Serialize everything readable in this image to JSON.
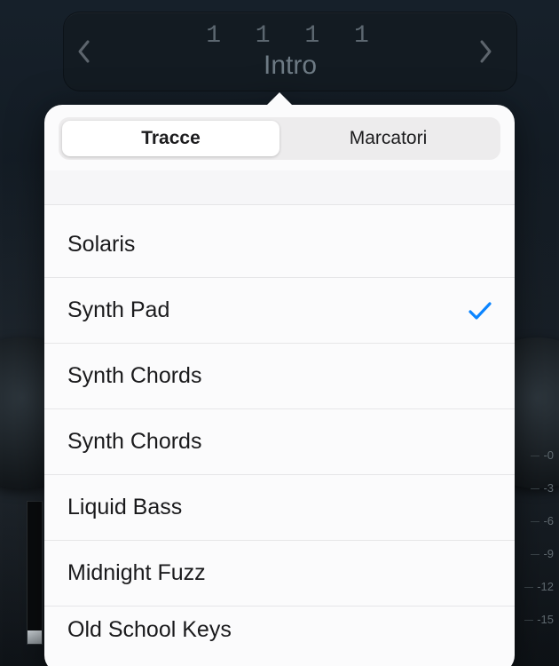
{
  "nav": {
    "position": "1 1 1   1",
    "marker": "Intro"
  },
  "segmented": {
    "tracks_label": "Tracce",
    "markers_label": "Marcatori",
    "active": "tracks"
  },
  "tracks": [
    {
      "name": "Solaris",
      "selected": false
    },
    {
      "name": "Synth Pad",
      "selected": true
    },
    {
      "name": "Synth Chords",
      "selected": false
    },
    {
      "name": "Synth Chords",
      "selected": false
    },
    {
      "name": "Liquid Bass",
      "selected": false
    },
    {
      "name": "Midnight Fuzz",
      "selected": false
    },
    {
      "name": "Old School Keys",
      "selected": false
    }
  ],
  "meter_db_ticks": [
    "-0",
    "-3",
    "-6",
    "-9",
    "-12",
    "-15"
  ]
}
